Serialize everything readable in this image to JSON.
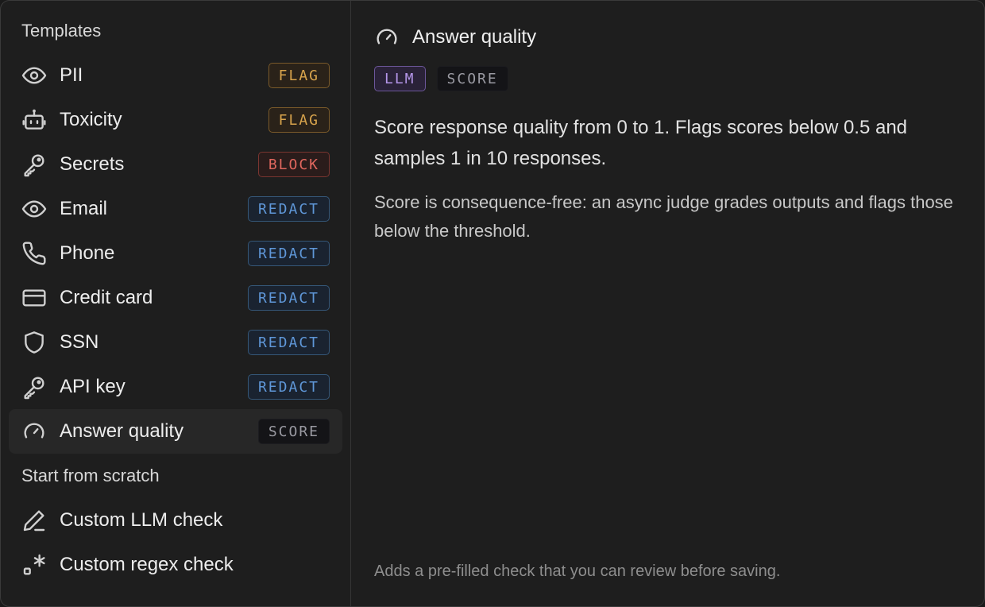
{
  "sidebar": {
    "templates_title": "Templates",
    "templates": [
      {
        "label": "PII",
        "badge": "FLAG",
        "kind": "flag",
        "icon": "eye-icon"
      },
      {
        "label": "Toxicity",
        "badge": "FLAG",
        "kind": "flag",
        "icon": "robot-icon"
      },
      {
        "label": "Secrets",
        "badge": "BLOCK",
        "kind": "block",
        "icon": "key-icon"
      },
      {
        "label": "Email",
        "badge": "REDACT",
        "kind": "redact",
        "icon": "eye-icon"
      },
      {
        "label": "Phone",
        "badge": "REDACT",
        "kind": "redact",
        "icon": "phone-icon"
      },
      {
        "label": "Credit card",
        "badge": "REDACT",
        "kind": "redact",
        "icon": "credit-card-icon"
      },
      {
        "label": "SSN",
        "badge": "REDACT",
        "kind": "redact",
        "icon": "shield-icon"
      },
      {
        "label": "API key",
        "badge": "REDACT",
        "kind": "redact",
        "icon": "key-icon"
      },
      {
        "label": "Answer quality",
        "badge": "SCORE",
        "kind": "score",
        "icon": "gauge-icon",
        "selected": true
      }
    ],
    "scratch_title": "Start from scratch",
    "scratch": [
      {
        "label": "Custom LLM check",
        "icon": "pencil-icon"
      },
      {
        "label": "Custom regex check",
        "icon": "regex-icon"
      }
    ]
  },
  "detail": {
    "title": "Answer quality",
    "icon": "gauge-icon",
    "tags": [
      "LLM",
      "SCORE"
    ],
    "description": "Score response quality from 0 to 1. Flags scores below 0.5 and samples 1 in 10 responses.",
    "note": "Score is consequence-free: an async judge grades outputs and flags those below the threshold.",
    "footer": "Adds a pre-filled check that you can review before saving."
  },
  "colors": {
    "flag": "#d8a44c",
    "block": "#e0675e",
    "redact": "#5f97d8",
    "score": "#9a9aa2",
    "llm": "#b495e8"
  }
}
